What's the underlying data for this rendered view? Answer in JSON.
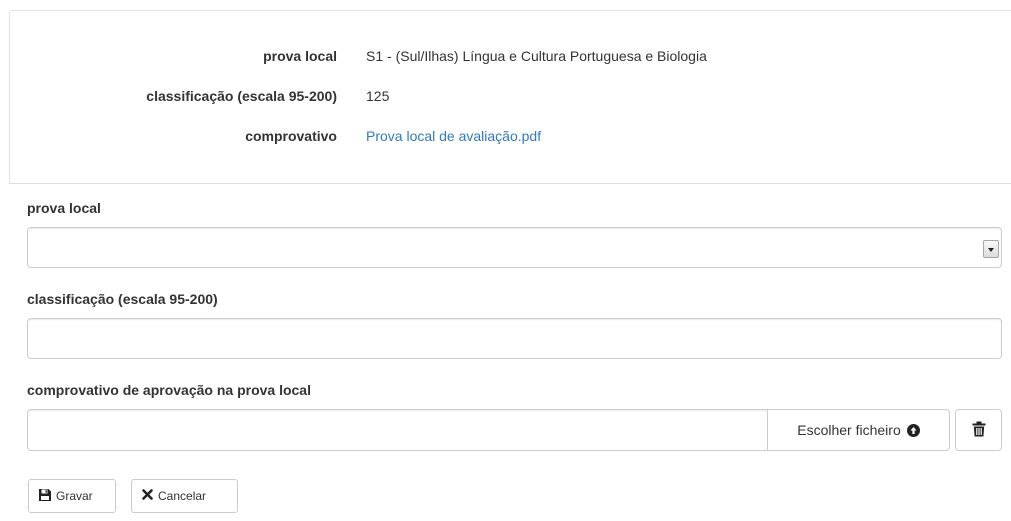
{
  "summary": {
    "rows": [
      {
        "label": "prova local",
        "value": "S1 - (Sul/Ilhas) Língua e Cultura Portuguesa e Biologia"
      },
      {
        "label": "classificação (escala 95-200)",
        "value": "125"
      },
      {
        "label": "comprovativo",
        "value": "Prova local de avaliação.pdf"
      }
    ]
  },
  "form": {
    "prova_local": {
      "label": "prova local",
      "value": ""
    },
    "classificacao": {
      "label": "classificação (escala 95-200)",
      "value": ""
    },
    "comprovativo": {
      "label": "comprovativo de aprovação na prova local",
      "value": "",
      "choose_label": "Escolher ficheiro"
    }
  },
  "actions": {
    "save_label": "Gravar",
    "cancel_label": "Cancelar"
  },
  "icons": {
    "upload": "upload-circle-icon",
    "trash": "trash-icon",
    "save": "floppy-disk-icon",
    "cancel": "x-mark-icon"
  },
  "colors": {
    "link": "#337ab7",
    "text": "#333333",
    "border": "#cccccc"
  }
}
